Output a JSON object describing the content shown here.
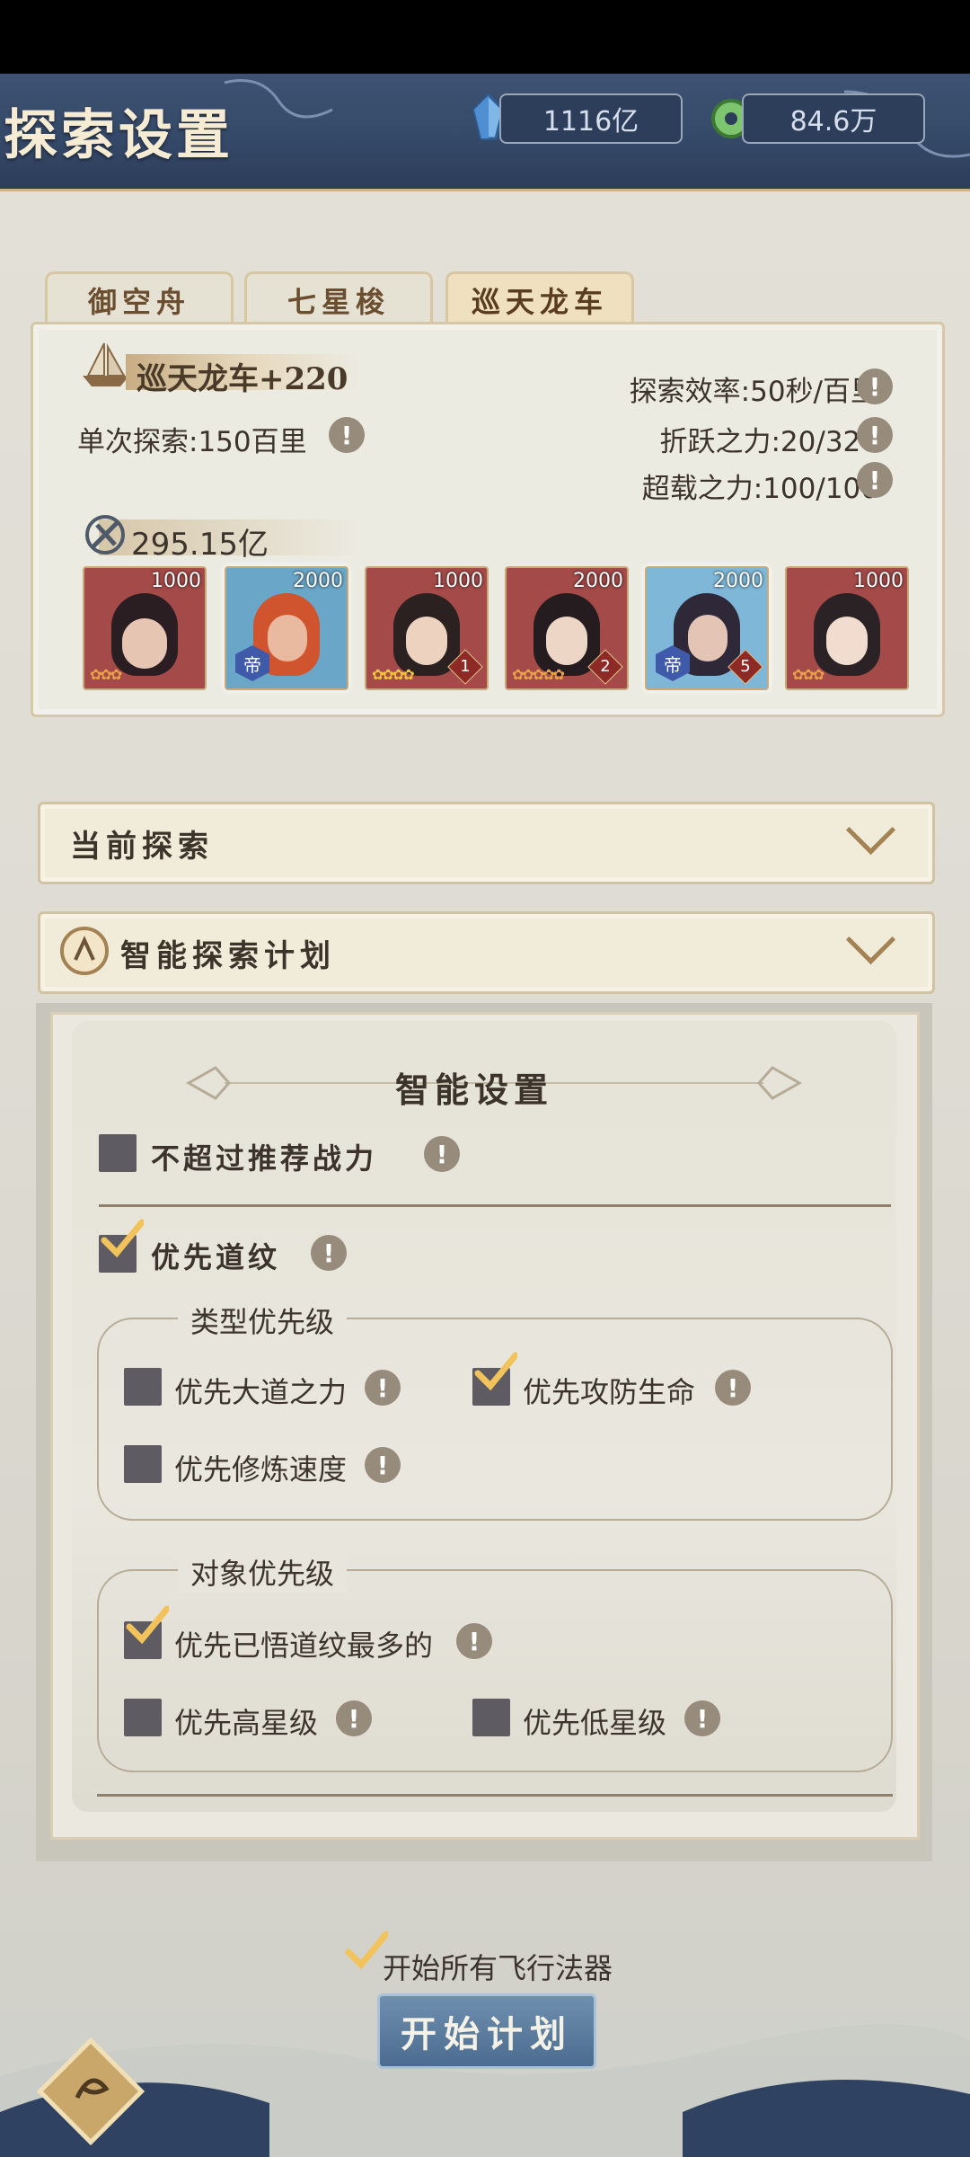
{
  "header": {
    "title": "探索设置",
    "spirit_stones": "1116亿",
    "jade": "84.6万"
  },
  "tabs": [
    "御空舟",
    "七星梭",
    "巡天龙车"
  ],
  "info": {
    "vehicle_name": "巡天龙车+220",
    "single_explore": "单次探索:150百里",
    "efficiency": "探索效率:50秒/百里",
    "leap_power": "折跃之力:20/320",
    "load_power": "超载之力:100/100",
    "power": "295.15亿",
    "heroes": [
      {
        "cost": "1000",
        "badge": "",
        "level": "",
        "stars": "✿✿✿"
      },
      {
        "cost": "2000",
        "badge": "帝",
        "level": "",
        "stars": ""
      },
      {
        "cost": "1000",
        "badge": "",
        "level": "1",
        "stars": "✿✿✿✿"
      },
      {
        "cost": "2000",
        "badge": "",
        "level": "2",
        "stars": "✿✿✿✿✿"
      },
      {
        "cost": "2000",
        "badge": "帝",
        "level": "5",
        "stars": ""
      },
      {
        "cost": "1000",
        "badge": "",
        "level": "",
        "stars": "✿✿✿"
      }
    ]
  },
  "sections": {
    "current": "当前探索",
    "smart_plan": "智能探索计划"
  },
  "settings": {
    "title": "智能设置",
    "no_exceed": "不超过推荐战力",
    "prefer_dao": "优先道纹",
    "type_priority": "类型优先级",
    "prefer_dao_power": "优先大道之力",
    "prefer_atk_def_hp": "优先攻防生命",
    "prefer_cultivation_speed": "优先修炼速度",
    "target_priority": "对象优先级",
    "prefer_most_dao": "优先已悟道纹最多的",
    "prefer_high_star": "优先高星级",
    "prefer_low_star": "优先低星级"
  },
  "footer": {
    "start_all": "开始所有飞行法器",
    "start_plan": "开始计划"
  },
  "colors": {
    "header_bg": "#344867",
    "accent_gold": "#c9a97a",
    "checkmark": "#f2c35a",
    "button_blue": "#5b7b9f"
  }
}
